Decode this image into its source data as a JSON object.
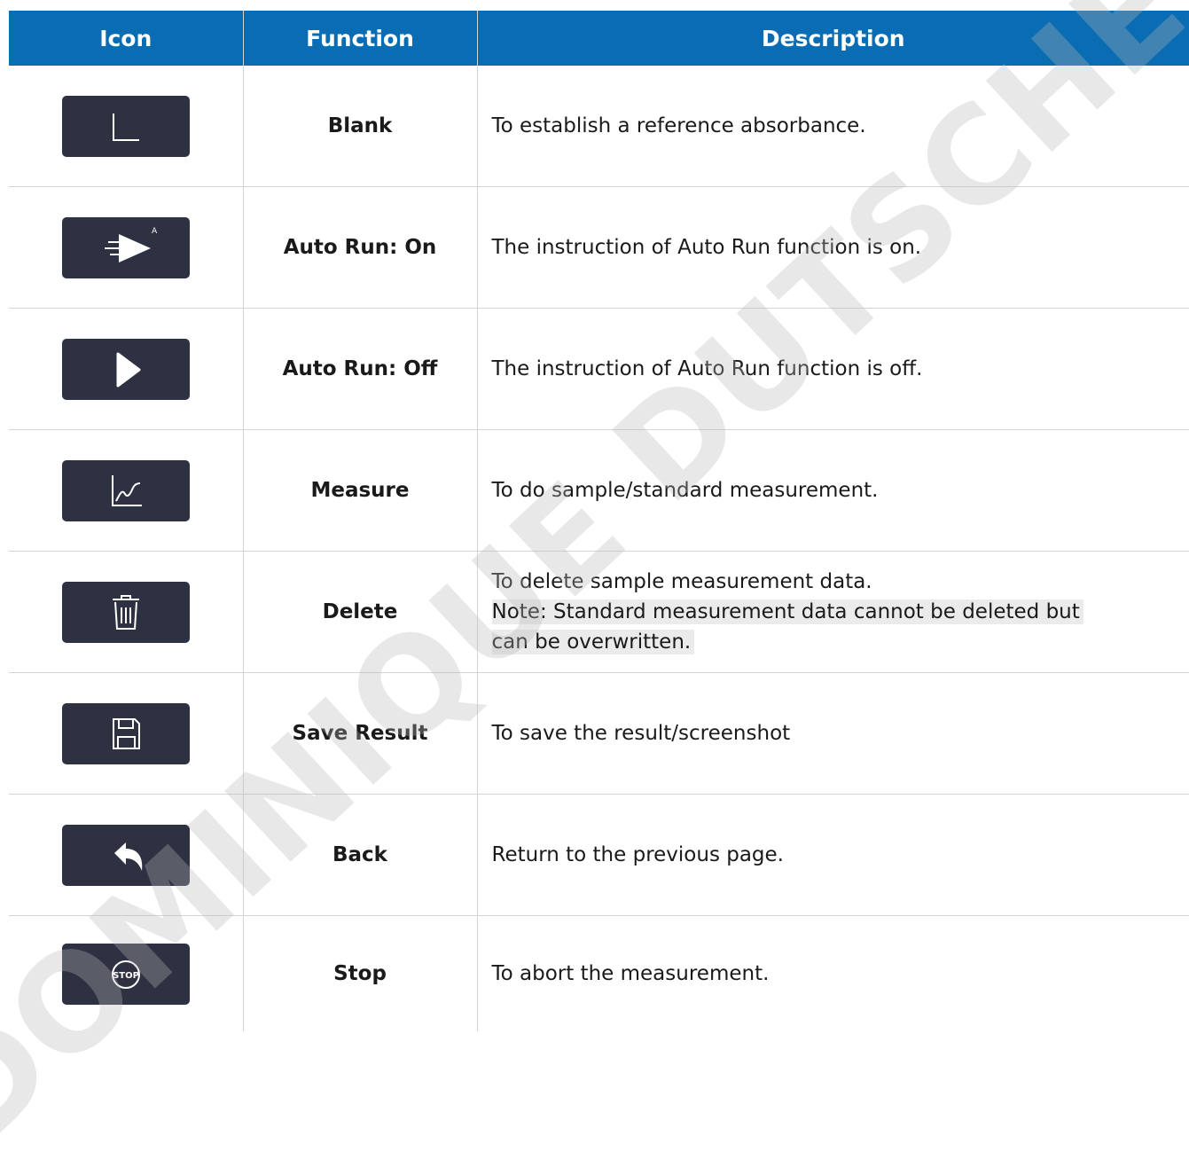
{
  "table": {
    "headers": {
      "icon": "Icon",
      "function": "Function",
      "description": "Description"
    },
    "rows": [
      {
        "icon": "blank-axes-icon",
        "function": "Blank",
        "description": "To establish a reference absorbance."
      },
      {
        "icon": "auto-run-on-icon",
        "function": "Auto Run: On",
        "description": "The instruction of Auto Run function is on."
      },
      {
        "icon": "play-icon",
        "function": "Auto Run: Off",
        "description": "The instruction of Auto Run function is off."
      },
      {
        "icon": "measure-graph-icon",
        "function": "Measure",
        "description": "To do sample/standard measurement."
      },
      {
        "icon": "trash-icon",
        "function": "Delete",
        "description": "To delete sample measurement data.",
        "note_line1": "Note: Standard measurement data cannot be deleted but",
        "note_line2": "can be overwritten."
      },
      {
        "icon": "floppy-disk-icon",
        "function": "Save Result",
        "description": "To save the result/screenshot"
      },
      {
        "icon": "back-arrow-icon",
        "function": "Back",
        "description": "Return to the previous page."
      },
      {
        "icon": "stop-icon",
        "function": "Stop",
        "description": "To abort the measurement."
      }
    ]
  },
  "watermark": "DOMINIQUE DUTSCHER",
  "colors": {
    "header_bg": "#0a6cb3",
    "header_text": "#ffffff",
    "icon_button_bg": "#2e3142",
    "grid_line": "#d4d4d4",
    "note_highlight": "#ebebeb"
  }
}
